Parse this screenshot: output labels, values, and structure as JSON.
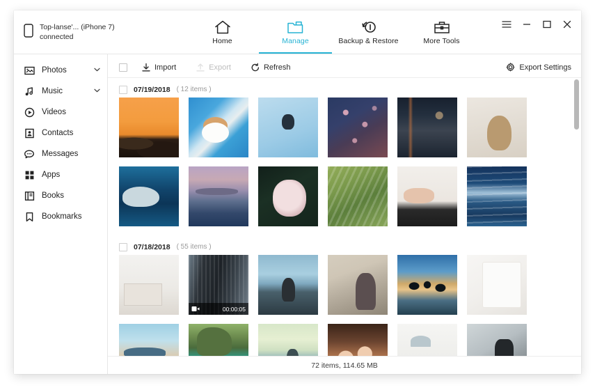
{
  "window": {
    "device_name": "Top-lanse'... (iPhone 7)",
    "device_status": "connected",
    "controls": {
      "menu": "menu-icon",
      "minimize": "minimize-icon",
      "maximize": "maximize-icon",
      "close": "close-icon"
    }
  },
  "accent_color": "#27b3d4",
  "nav_tabs": [
    {
      "label": "Home",
      "icon": "home-icon",
      "active": false
    },
    {
      "label": "Manage",
      "icon": "folder-icon",
      "active": true
    },
    {
      "label": "Backup & Restore",
      "icon": "backup-restore-icon",
      "active": false
    },
    {
      "label": "More Tools",
      "icon": "toolbox-icon",
      "active": false
    }
  ],
  "sidebar": {
    "items": [
      {
        "label": "Photos",
        "icon": "photos-icon",
        "expandable": true,
        "chevron": "˅",
        "active": true
      },
      {
        "label": "Music",
        "icon": "music-icon",
        "expandable": true,
        "chevron": "˅",
        "active": false
      },
      {
        "label": "Videos",
        "icon": "videos-icon",
        "expandable": false,
        "chevron": "",
        "active": false
      },
      {
        "label": "Contacts",
        "icon": "contacts-icon",
        "expandable": false,
        "chevron": "",
        "active": false
      },
      {
        "label": "Messages",
        "icon": "messages-icon",
        "expandable": false,
        "chevron": "",
        "active": false
      },
      {
        "label": "Apps",
        "icon": "apps-icon",
        "expandable": false,
        "chevron": "",
        "active": false
      },
      {
        "label": "Books",
        "icon": "books-icon",
        "expandable": false,
        "chevron": "",
        "active": false
      },
      {
        "label": "Bookmarks",
        "icon": "bookmarks-icon",
        "expandable": false,
        "chevron": "",
        "active": false
      }
    ]
  },
  "toolbar": {
    "select_all_checked": false,
    "import_label": "Import",
    "export_label": "Export",
    "export_disabled": true,
    "refresh_label": "Refresh",
    "export_settings_label": "Export Settings"
  },
  "gallery": {
    "groups": [
      {
        "date": "07/19/2018",
        "count_label": "( 12 items )",
        "checked": false,
        "rows": [
          [
            {
              "name": "sunset-beach",
              "art": "p-sunset",
              "type": "photo"
            },
            {
              "name": "pool-sunhat",
              "art": "p-pool1",
              "type": "photo"
            },
            {
              "name": "pool-aerial",
              "art": "p-pool2",
              "type": "photo"
            },
            {
              "name": "cherry-blossom",
              "art": "p-blossom",
              "type": "photo"
            },
            {
              "name": "night-alley",
              "art": "p-alley",
              "type": "photo"
            },
            {
              "name": "deer-portrait",
              "art": "p-deer",
              "type": "photo"
            }
          ],
          [
            {
              "name": "beluga-whale",
              "art": "p-beluga",
              "type": "photo"
            },
            {
              "name": "dusk-mountain",
              "art": "p-dusk",
              "type": "photo"
            },
            {
              "name": "pink-flower",
              "art": "p-flower",
              "type": "photo"
            },
            {
              "name": "rice-terrace",
              "art": "p-terrace",
              "type": "photo"
            },
            {
              "name": "washing-hands",
              "art": "p-wash",
              "type": "photo"
            },
            {
              "name": "ocean-waves",
              "art": "p-waves",
              "type": "photo"
            }
          ]
        ]
      },
      {
        "date": "07/18/2018",
        "count_label": "( 55 items )",
        "checked": false,
        "rows": [
          [
            {
              "name": "living-room",
              "art": "p-livingroom",
              "type": "photo"
            },
            {
              "name": "city-building",
              "art": "p-building",
              "type": "video",
              "duration": "00:00:05"
            },
            {
              "name": "person-sitting-beach",
              "art": "p-sitbeach",
              "type": "photo"
            },
            {
              "name": "st-peters-square",
              "art": "p-square",
              "type": "photo"
            },
            {
              "name": "friends-jumping",
              "art": "p-jump",
              "type": "photo"
            },
            {
              "name": "white-tshirt-flatlay",
              "art": "p-shirt",
              "type": "photo"
            }
          ],
          [
            {
              "name": "thai-beach",
              "art": "p-thaibeach",
              "type": "photo"
            },
            {
              "name": "limestone-cliff",
              "art": "p-cliff",
              "type": "photo"
            },
            {
              "name": "couple-sea-sunset",
              "art": "p-couple",
              "type": "photo"
            },
            {
              "name": "friends-candlelight",
              "art": "p-friends",
              "type": "photo"
            },
            {
              "name": "pendant-lamp",
              "art": "p-lamp",
              "type": "photo"
            },
            {
              "name": "cat-on-desk",
              "art": "p-cat",
              "type": "photo"
            }
          ]
        ]
      }
    ]
  },
  "status": {
    "summary": "72 items, 114.65 MB"
  }
}
